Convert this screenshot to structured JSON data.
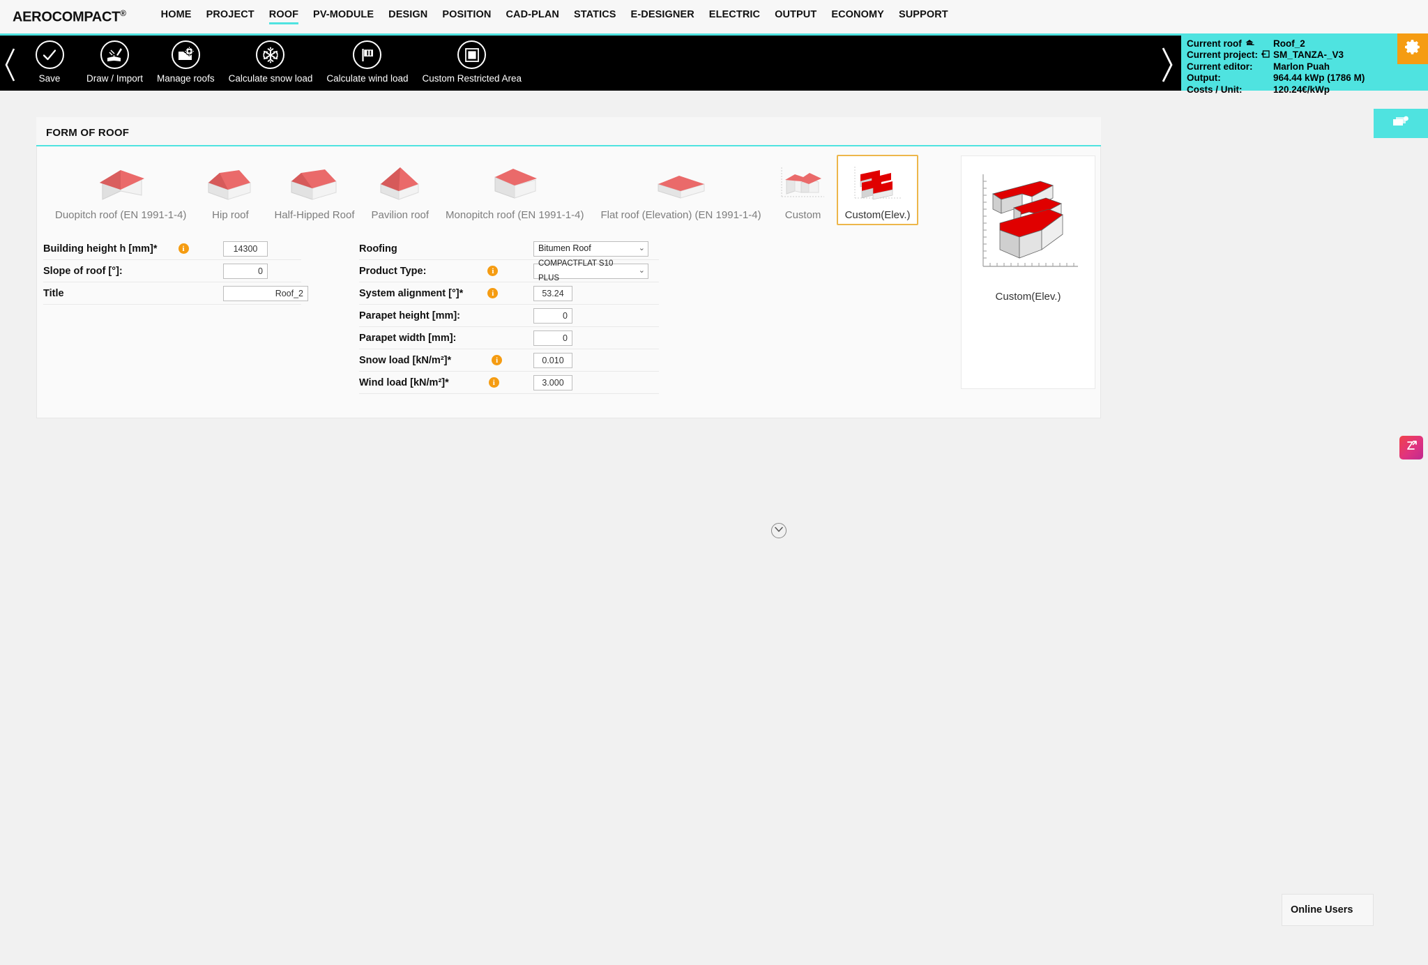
{
  "brand": {
    "name": "AEROCOMPACT",
    "registered": "®"
  },
  "nav": {
    "items": [
      {
        "label": "HOME",
        "active": false
      },
      {
        "label": "PROJECT",
        "active": false
      },
      {
        "label": "ROOF",
        "active": true
      },
      {
        "label": "PV-MODULE",
        "active": false
      },
      {
        "label": "DESIGN",
        "active": false
      },
      {
        "label": "POSITION",
        "active": false
      },
      {
        "label": "CAD-PLAN",
        "active": false
      },
      {
        "label": "STATICS",
        "active": false
      },
      {
        "label": "E-DESIGNER",
        "active": false
      },
      {
        "label": "ELECTRIC",
        "active": false
      },
      {
        "label": "OUTPUT",
        "active": false
      },
      {
        "label": "ECONOMY",
        "active": false
      },
      {
        "label": "SUPPORT",
        "active": false
      }
    ]
  },
  "toolbar": {
    "items": [
      {
        "label": "Save",
        "icon": "check-icon"
      },
      {
        "label": "Draw / Import",
        "icon": "draw-import-icon"
      },
      {
        "label": "Manage roofs",
        "icon": "manage-roofs-icon"
      },
      {
        "label": "Calculate snow load",
        "icon": "snowflake-icon"
      },
      {
        "label": "Calculate wind load",
        "icon": "wind-flag-icon"
      },
      {
        "label": "Custom Restricted Area",
        "icon": "restricted-area-icon"
      }
    ]
  },
  "info": {
    "rows": [
      {
        "label": "Current roof",
        "icon": "roof-icon",
        "value": "Roof_2"
      },
      {
        "label": "Current project:",
        "icon": "project-icon",
        "value": "SM_TANZA-_V3"
      },
      {
        "label": "Current editor:",
        "icon": "",
        "value": "Marlon Puah"
      },
      {
        "label": "Output:",
        "icon": "",
        "value": "964.44 kWp (1786 M)"
      },
      {
        "label": "Costs / Unit:",
        "icon": "",
        "value": "120.24€/kWp"
      }
    ],
    "gear_icon": "gear-icon",
    "accent_color": "#4fe3e0",
    "gear_color": "#f59c12"
  },
  "card": {
    "title": "FORM OF ROOF",
    "roof_types": [
      {
        "label": "Duopitch roof (EN 1991-1-4)",
        "shape": "duopitch",
        "selected": false
      },
      {
        "label": "Hip roof",
        "shape": "hip",
        "selected": false
      },
      {
        "label": "Half-Hipped Roof",
        "shape": "half-hipped",
        "selected": false
      },
      {
        "label": "Pavilion roof",
        "shape": "pavilion",
        "selected": false
      },
      {
        "label": "Monopitch roof (EN 1991-1-4)",
        "shape": "monopitch",
        "selected": false
      },
      {
        "label": "Flat roof (Elevation) (EN 1991-1-4)",
        "shape": "flat",
        "selected": false
      },
      {
        "label": "Custom",
        "shape": "custom",
        "selected": false
      },
      {
        "label": "Custom(Elev.)",
        "shape": "custom-elev",
        "selected": true
      }
    ],
    "preview": {
      "label": "Custom(Elev.)"
    },
    "left_fields": [
      {
        "label": "Building height h [mm]*",
        "info": true,
        "type": "text",
        "value": "14300",
        "align": "center"
      },
      {
        "label": "Slope of roof [°]:",
        "info": false,
        "type": "text",
        "value": "0",
        "align": "right"
      },
      {
        "label": "Title",
        "info": false,
        "type": "text",
        "value": "Roof_2",
        "align": "right"
      }
    ],
    "right_fields": [
      {
        "label": "Roofing",
        "info": false,
        "type": "select",
        "value": "Bitumen Roof"
      },
      {
        "label": "Product Type:",
        "info": true,
        "type": "select",
        "value": "COMPACTFLAT S10 PLUS"
      },
      {
        "label": "System alignment [°]*",
        "info": true,
        "type": "text",
        "value": "53.24",
        "align": "center"
      },
      {
        "label": "Parapet height [mm]:",
        "info": false,
        "type": "text",
        "value": "0",
        "align": "right"
      },
      {
        "label": "Parapet width [mm]:",
        "info": false,
        "type": "text",
        "value": "0",
        "align": "right"
      },
      {
        "label": "Snow load [kN/m²]*",
        "info": true,
        "type": "text",
        "value": "0.010",
        "align": "center"
      },
      {
        "label": "Wind load [kN/m²]*",
        "info": true,
        "type": "text",
        "value": "3.000",
        "align": "center"
      }
    ],
    "expand_icon": "chevron-down-circle-icon"
  },
  "widgets": {
    "zoom_widget_icon": "expand-arrows-icon",
    "online_users_label": "Online Users"
  }
}
